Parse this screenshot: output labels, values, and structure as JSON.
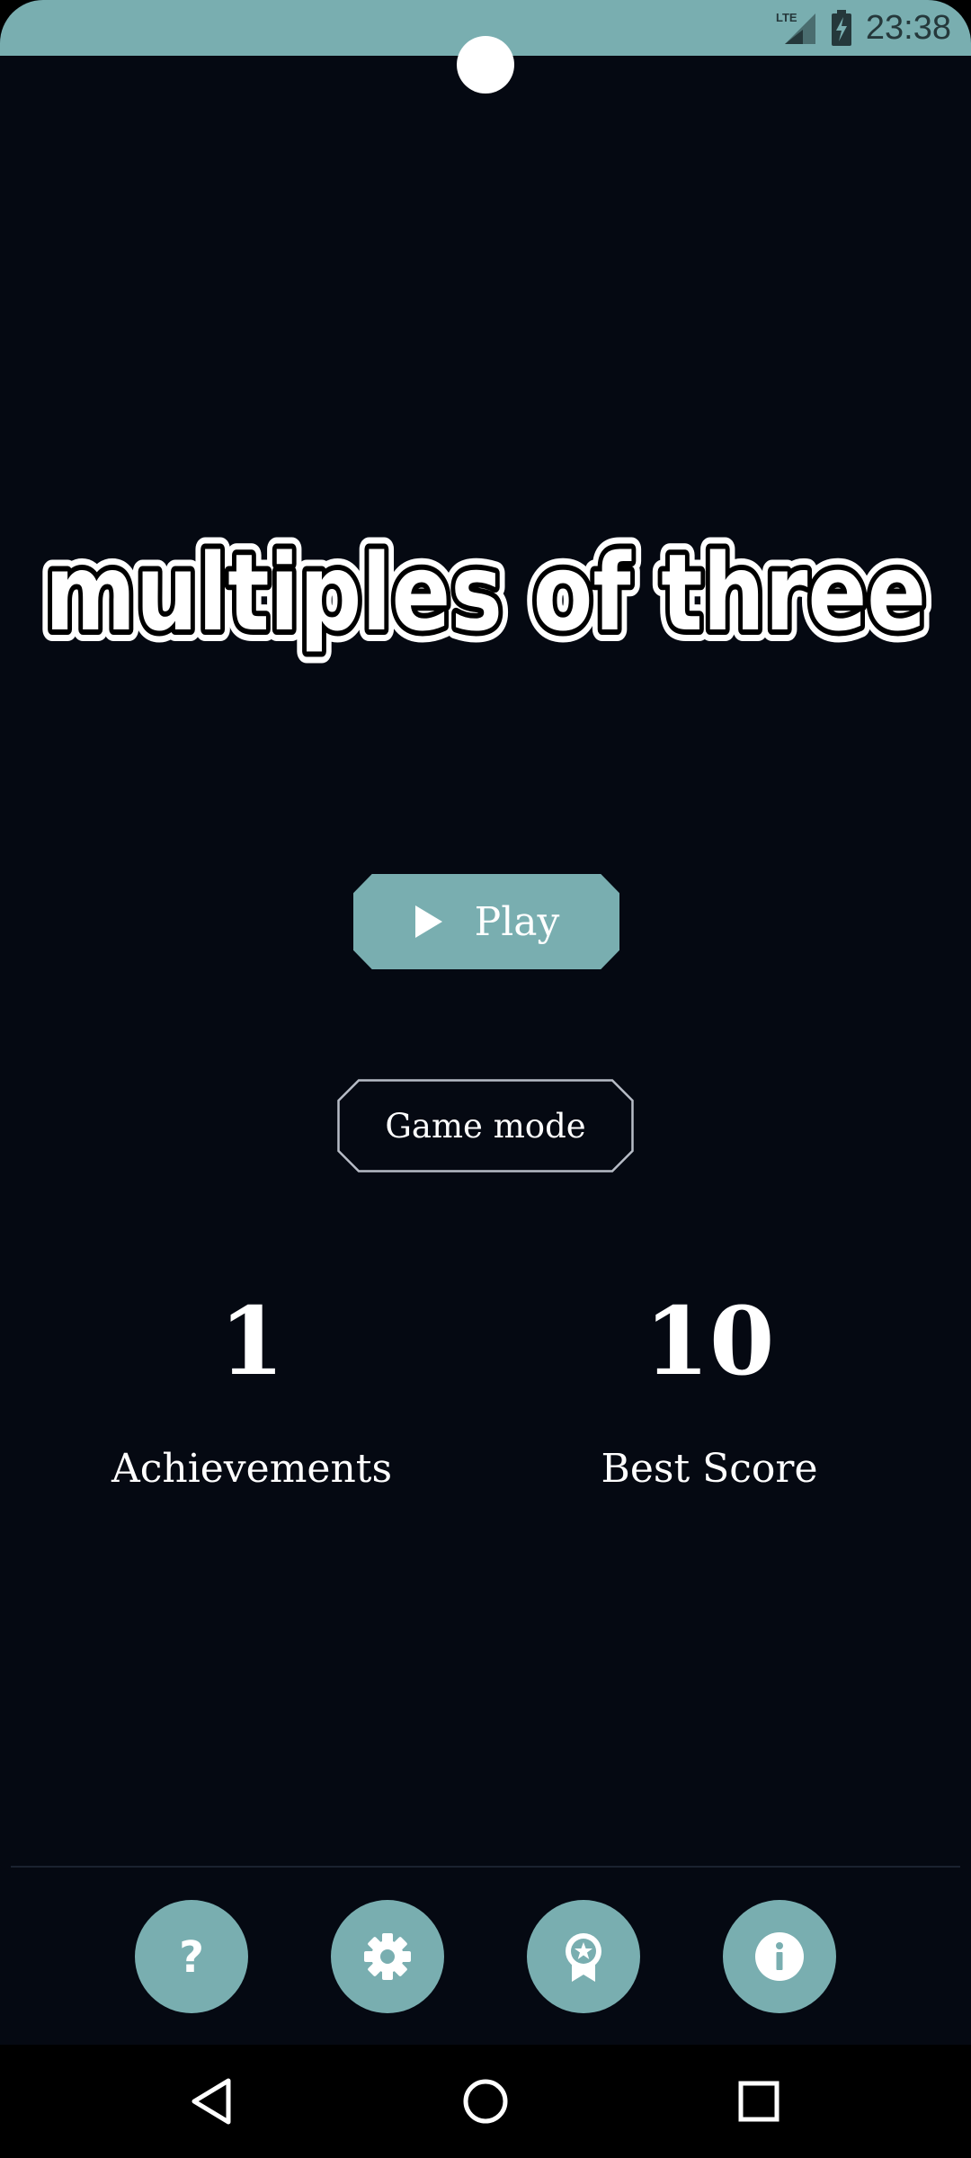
{
  "status_bar": {
    "network": "LTE",
    "time": "23:38"
  },
  "title": "multiples of three",
  "buttons": {
    "play_label": "Play",
    "game_mode_label": "Game mode"
  },
  "stats": [
    {
      "value": "1",
      "label": "Achievements"
    },
    {
      "value": "10",
      "label": "Best Score"
    }
  ],
  "bottom_icons": [
    "help-icon",
    "settings-icon",
    "achievement-icon",
    "info-icon"
  ],
  "colors": {
    "accent": "#79aeb0",
    "background": "#050912",
    "text": "#ffffff"
  }
}
